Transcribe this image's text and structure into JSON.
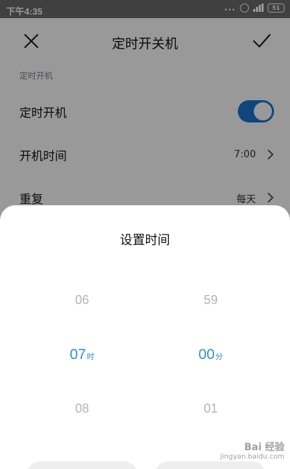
{
  "status_bar": {
    "time": "下午4:35",
    "more": "...",
    "battery": "51"
  },
  "header": {
    "title": "定时开关机"
  },
  "section": {
    "label": "定时开机"
  },
  "rows": {
    "power_on": {
      "label": "定时开机",
      "enabled": true
    },
    "power_on_time": {
      "label": "开机时间",
      "value": "7:00"
    },
    "repeat": {
      "label": "重复",
      "value": "每天"
    }
  },
  "time_sheet": {
    "title": "设置时间",
    "hours": {
      "prev": "06",
      "selected": "07",
      "unit": "时",
      "next": "08"
    },
    "minutes": {
      "prev": "59",
      "selected": "00",
      "unit": "分",
      "next": "01"
    }
  },
  "watermark": {
    "line1": "Bai 经验",
    "line2": "jingyan.baidu.com"
  },
  "colors": {
    "accent": "#1976d2",
    "picker_selected": "#2f8fd9"
  }
}
